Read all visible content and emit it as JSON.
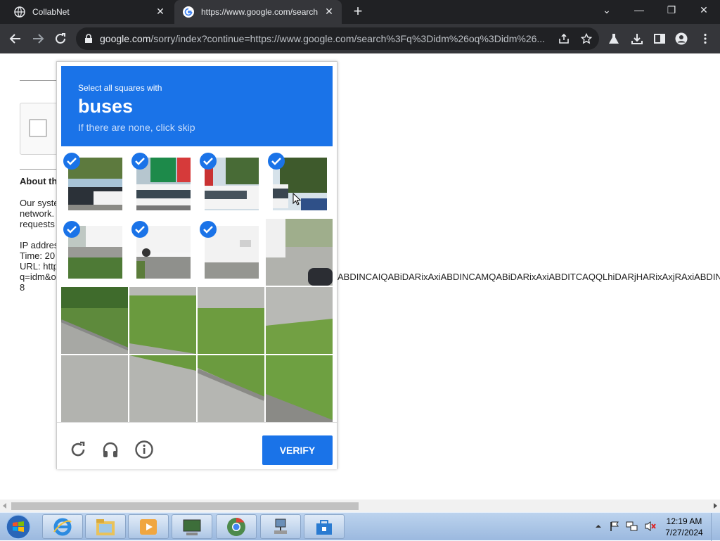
{
  "browser": {
    "tabs": [
      {
        "title": "CollabNet",
        "close": "✕"
      },
      {
        "title": "https://www.google.com/search",
        "close": "✕"
      }
    ],
    "new_tab": "+",
    "window_controls": {
      "minimize": "—",
      "restore": "❐",
      "close": "✕",
      "tab_search": "⌄"
    },
    "address": {
      "host": "google.com",
      "path": "/sorry/index?continue=https://www.google.com/search%3Fq%3Didm%26oq%3Didm%26..."
    },
    "icons": [
      "back-icon",
      "forward-icon",
      "reload-icon",
      "lock-icon",
      "share-icon",
      "star-icon",
      "labs-icon",
      "download-icon",
      "side-panel-icon",
      "profile-icon",
      "menu-icon"
    ]
  },
  "page": {
    "about_heading": "About th",
    "paragraph_lines": [
      "Our syste",
      "network.",
      "requests"
    ],
    "info_lines": [
      "IP addres",
      "Time: 20",
      "URL: http",
      "q=idm&o",
      "8"
    ],
    "long_url_tail": "ABDINCAIQABiDARixAxiABDINCAMQABiDARixAxiABDITCAQQLhiDARjHARixAxjRAxiABDINC"
  },
  "captcha": {
    "instruction_line1": "Select all squares with",
    "target": "buses",
    "instruction_line3": "If there are none, click skip",
    "selected_tiles": [
      0,
      1,
      2,
      3,
      4,
      5,
      6
    ],
    "tile_count": 16,
    "verify_label": "VERIFY",
    "colors": {
      "accent": "#1a73e8"
    }
  },
  "taskbar": {
    "time": "12:19 AM",
    "date": "7/27/2024",
    "apps": [
      "internet-explorer",
      "file-explorer",
      "media-player",
      "network-tool",
      "chrome",
      "network-config",
      "store"
    ]
  }
}
